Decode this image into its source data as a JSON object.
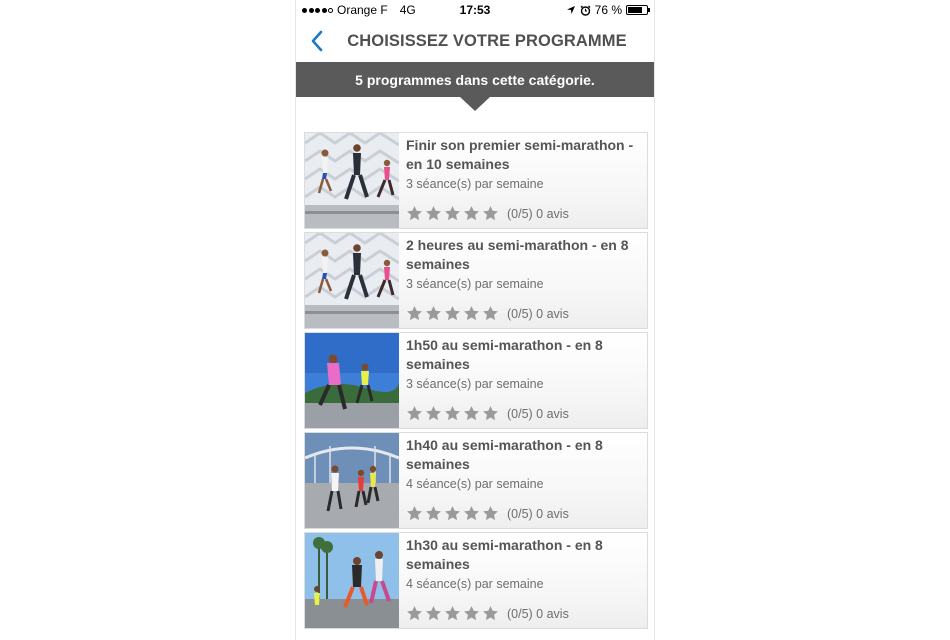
{
  "status_bar": {
    "carrier": "Orange F",
    "network": "4G",
    "time": "17:53",
    "battery": "76 %",
    "battery_level": 0.76
  },
  "header": {
    "title": "CHOISISSEZ VOTRE PROGRAMME",
    "back_icon": "chevron-left-icon",
    "accent_color": "#1a7bc4"
  },
  "banner": {
    "text": "5 programmes dans cette catégorie."
  },
  "programs": [
    {
      "title": "Finir son premier semi-marathon - en 10 semaines",
      "sessions": "3 séance(s) par semaine",
      "rating": 0,
      "rating_text": "(0/5) 0 avis",
      "thumbnail": "runners-white-structure"
    },
    {
      "title": "2 heures au semi-marathon - en 8 semaines",
      "sessions": "3 séance(s) par semaine",
      "rating": 0,
      "rating_text": "(0/5) 0 avis",
      "thumbnail": "runners-white-structure"
    },
    {
      "title": "1h50 au semi-marathon - en 8 semaines",
      "sessions": "3 séance(s) par semaine",
      "rating": 0,
      "rating_text": "(0/5) 0 avis",
      "thumbnail": "runners-blue-sky"
    },
    {
      "title": "1h40 au semi-marathon - en 8 semaines",
      "sessions": "4 séance(s) par semaine",
      "rating": 0,
      "rating_text": "(0/5) 0 avis",
      "thumbnail": "runners-bridge"
    },
    {
      "title": "1h30 au semi-marathon - en 8 semaines",
      "sessions": "4 séance(s) par semaine",
      "rating": 0,
      "rating_text": "(0/5) 0 avis",
      "thumbnail": "runners-palm-trees"
    }
  ],
  "colors": {
    "banner_bg": "#5a5a5a",
    "star_color": "#9a9a9a",
    "title_color": "#555555"
  }
}
